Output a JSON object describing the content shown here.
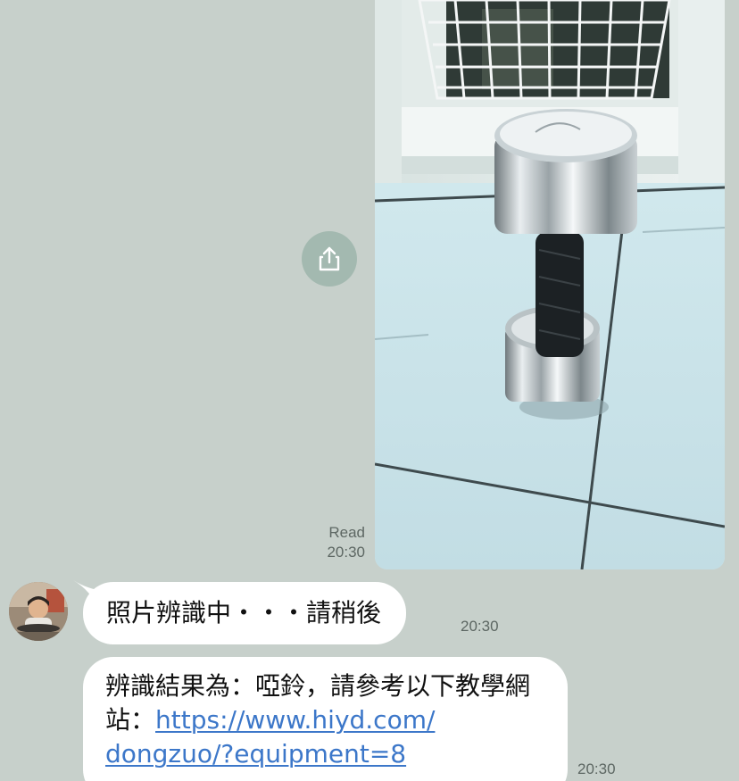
{
  "outgoing": {
    "photo": {
      "subject": "dumbbell"
    },
    "share_icon": "share-icon",
    "read_label": "Read",
    "time": "20:30"
  },
  "incoming": {
    "messages": [
      {
        "text": "照片辨識中・・・請稍後",
        "time": "20:30"
      },
      {
        "text_prefix": "辨識結果為：啞鈴，請參考以下教學網站：",
        "link_line1": "https://www.hiyd.com/",
        "link_line2": "dongzuo/?equipment=8",
        "time": "20:30"
      }
    ]
  },
  "colors": {
    "background": "#c7d0cb",
    "bubble": "#ffffff",
    "link": "#3c77c9",
    "share_button": "#a3b9b0"
  }
}
